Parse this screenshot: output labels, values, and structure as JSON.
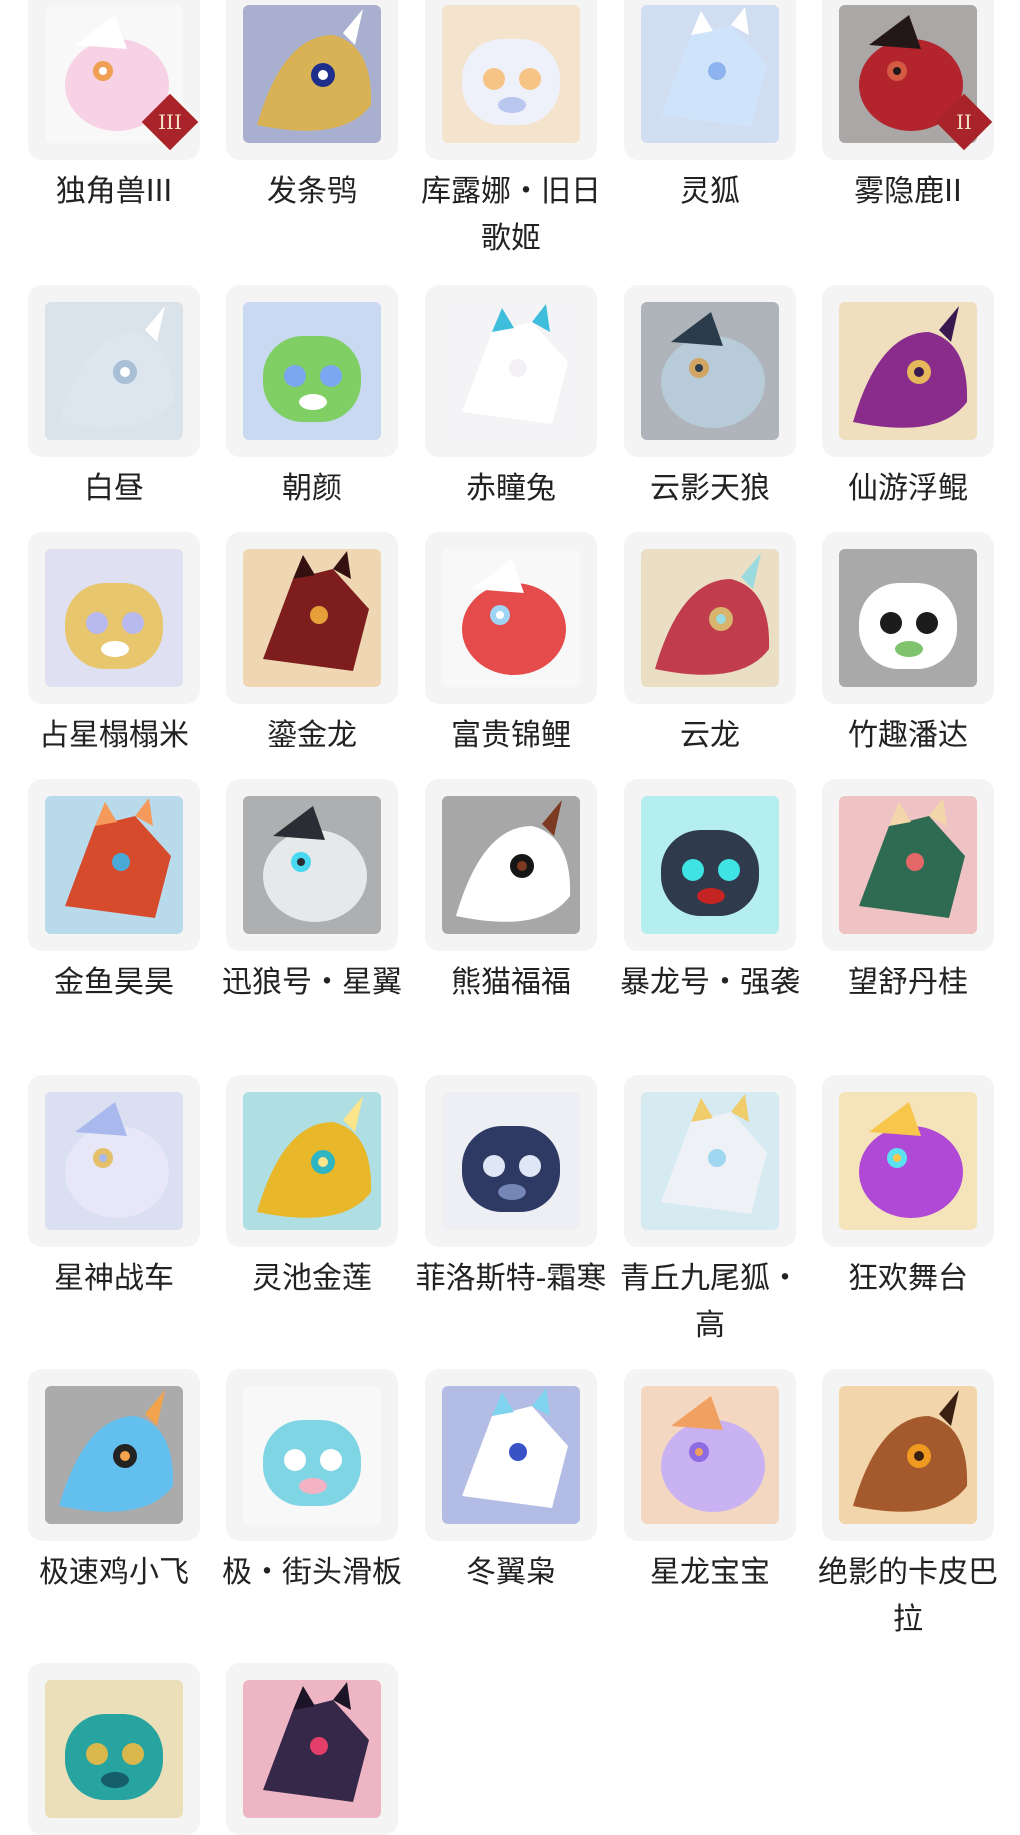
{
  "items": [
    {
      "name": "独角兽III",
      "icon": "unicorn-icon",
      "badge": "III",
      "colors": [
        "#f7d1e4",
        "#ffffff",
        "#f0a055"
      ]
    },
    {
      "name": "发条鸮",
      "icon": "clockwork-owl-icon",
      "colors": [
        "#d9b255",
        "#1d2f8a",
        "#ffffff"
      ]
    },
    {
      "name": "库露娜・旧日歌姬",
      "icon": "singer-girl-icon",
      "colors": [
        "#eef0fa",
        "#f6c585",
        "#b9c6f0"
      ]
    },
    {
      "name": "灵狐",
      "icon": "spirit-fox-icon",
      "colors": [
        "#cfe3fb",
        "#8eb4ef",
        "#ffffff"
      ]
    },
    {
      "name": "雾隐鹿II",
      "icon": "mist-deer-icon",
      "badge": "II",
      "colors": [
        "#b3242c",
        "#231817",
        "#d45a42"
      ]
    },
    {
      "name": "白昼",
      "icon": "white-dragon-icon",
      "colors": [
        "#dde5ee",
        "#a9bfd6",
        "#ffffff"
      ]
    },
    {
      "name": "朝颜",
      "icon": "morning-glory-icon",
      "colors": [
        "#7fcf64",
        "#7aa7ef",
        "#ffffff"
      ]
    },
    {
      "name": "赤瞳兔",
      "icon": "red-eye-rabbit-icon",
      "colors": [
        "#ffffff",
        "#f3f1f5",
        "#3fbedc"
      ]
    },
    {
      "name": "云影天狼",
      "icon": "sky-wolf-icon",
      "colors": [
        "#b7cbd9",
        "#2a3b4c",
        "#d1a563"
      ]
    },
    {
      "name": "仙游浮鲲",
      "icon": "floating-whale-icon",
      "colors": [
        "#8a2c8c",
        "#e5b85b",
        "#3a1950"
      ]
    },
    {
      "name": "占星榻榻米",
      "icon": "astrology-tent-icon",
      "colors": [
        "#e7c66d",
        "#b8b9ef",
        "#ffffff"
      ]
    },
    {
      "name": "鎏金龙",
      "icon": "gilded-dragon-icon",
      "colors": [
        "#7e1d1d",
        "#e5a03a",
        "#341010"
      ]
    },
    {
      "name": "富贵锦鲤",
      "icon": "koi-icon",
      "colors": [
        "#e54b4b",
        "#ffffff",
        "#9fd5f2"
      ]
    },
    {
      "name": "云龙",
      "icon": "cloud-dragon-icon",
      "colors": [
        "#c13d4d",
        "#d8b46d",
        "#9adbe0"
      ]
    },
    {
      "name": "竹趣潘达",
      "icon": "bamboo-panda-icon",
      "colors": [
        "#ffffff",
        "#1c1c1c",
        "#7fc46d"
      ]
    },
    {
      "name": "金鱼昊昊",
      "icon": "goldfish-icon",
      "colors": [
        "#d74b2d",
        "#4aa9d6",
        "#f59a5a"
      ]
    },
    {
      "name": "迅狼号・星翼",
      "icon": "mecha-wolf-icon",
      "colors": [
        "#e6e8ea",
        "#2a2d33",
        "#48d9f0"
      ]
    },
    {
      "name": "熊猫福福",
      "icon": "panda-icon",
      "colors": [
        "#ffffff",
        "#161616",
        "#7d3a22"
      ]
    },
    {
      "name": "暴龙号・强袭",
      "icon": "mecha-trex-icon",
      "colors": [
        "#2f3a4c",
        "#3fe3e3",
        "#c42424"
      ]
    },
    {
      "name": "望舒丹桂",
      "icon": "swing-chair-icon",
      "colors": [
        "#2f6b52",
        "#e46868",
        "#f3d6a9"
      ]
    },
    {
      "name": "星神战车",
      "icon": "star-horse-icon",
      "colors": [
        "#e7e7f7",
        "#a9b9ee",
        "#e4c06a"
      ]
    },
    {
      "name": "灵池金莲",
      "icon": "golden-lotus-icon",
      "colors": [
        "#e9b72a",
        "#2fb5c2",
        "#fde58a"
      ]
    },
    {
      "name": "菲洛斯特-霜寒",
      "icon": "frost-knight-icon",
      "colors": [
        "#2e3a63",
        "#dfe6f5",
        "#7686b6"
      ]
    },
    {
      "name": "青丘九尾狐・高",
      "icon": "nine-tail-fox-icon",
      "colors": [
        "#eef2f6",
        "#9ed7ef",
        "#f0cd6a"
      ]
    },
    {
      "name": "狂欢舞台",
      "icon": "carnival-stage-icon",
      "colors": [
        "#b049d6",
        "#f7c64a",
        "#5be1f0"
      ]
    },
    {
      "name": "极速鸡小飞",
      "icon": "blue-chick-icon",
      "colors": [
        "#63c0ee",
        "#232323",
        "#f3a24d"
      ]
    },
    {
      "name": "极・街头滑板",
      "icon": "skateboard-icon",
      "colors": [
        "#7fd5e3",
        "#ffffff",
        "#f4b3c4"
      ]
    },
    {
      "name": "冬翼枭",
      "icon": "winter-owl-icon",
      "colors": [
        "#ffffff",
        "#3952c5",
        "#7fd3ee"
      ]
    },
    {
      "name": "星龙宝宝",
      "icon": "star-dragon-baby-icon",
      "colors": [
        "#c9b2f2",
        "#f0a060",
        "#8e6be3"
      ]
    },
    {
      "name": "绝影的卡皮巴拉",
      "icon": "capybara-icon",
      "colors": [
        "#a45a2d",
        "#f19a22",
        "#3a2010"
      ]
    },
    {
      "name": "",
      "icon": "jade-dragon-icon",
      "colors": [
        "#27a3a0",
        "#d9b74a",
        "#155e6a"
      ]
    },
    {
      "name": "",
      "icon": "dark-dragon-icon",
      "colors": [
        "#352849",
        "#e2406a",
        "#1a1426"
      ]
    }
  ]
}
